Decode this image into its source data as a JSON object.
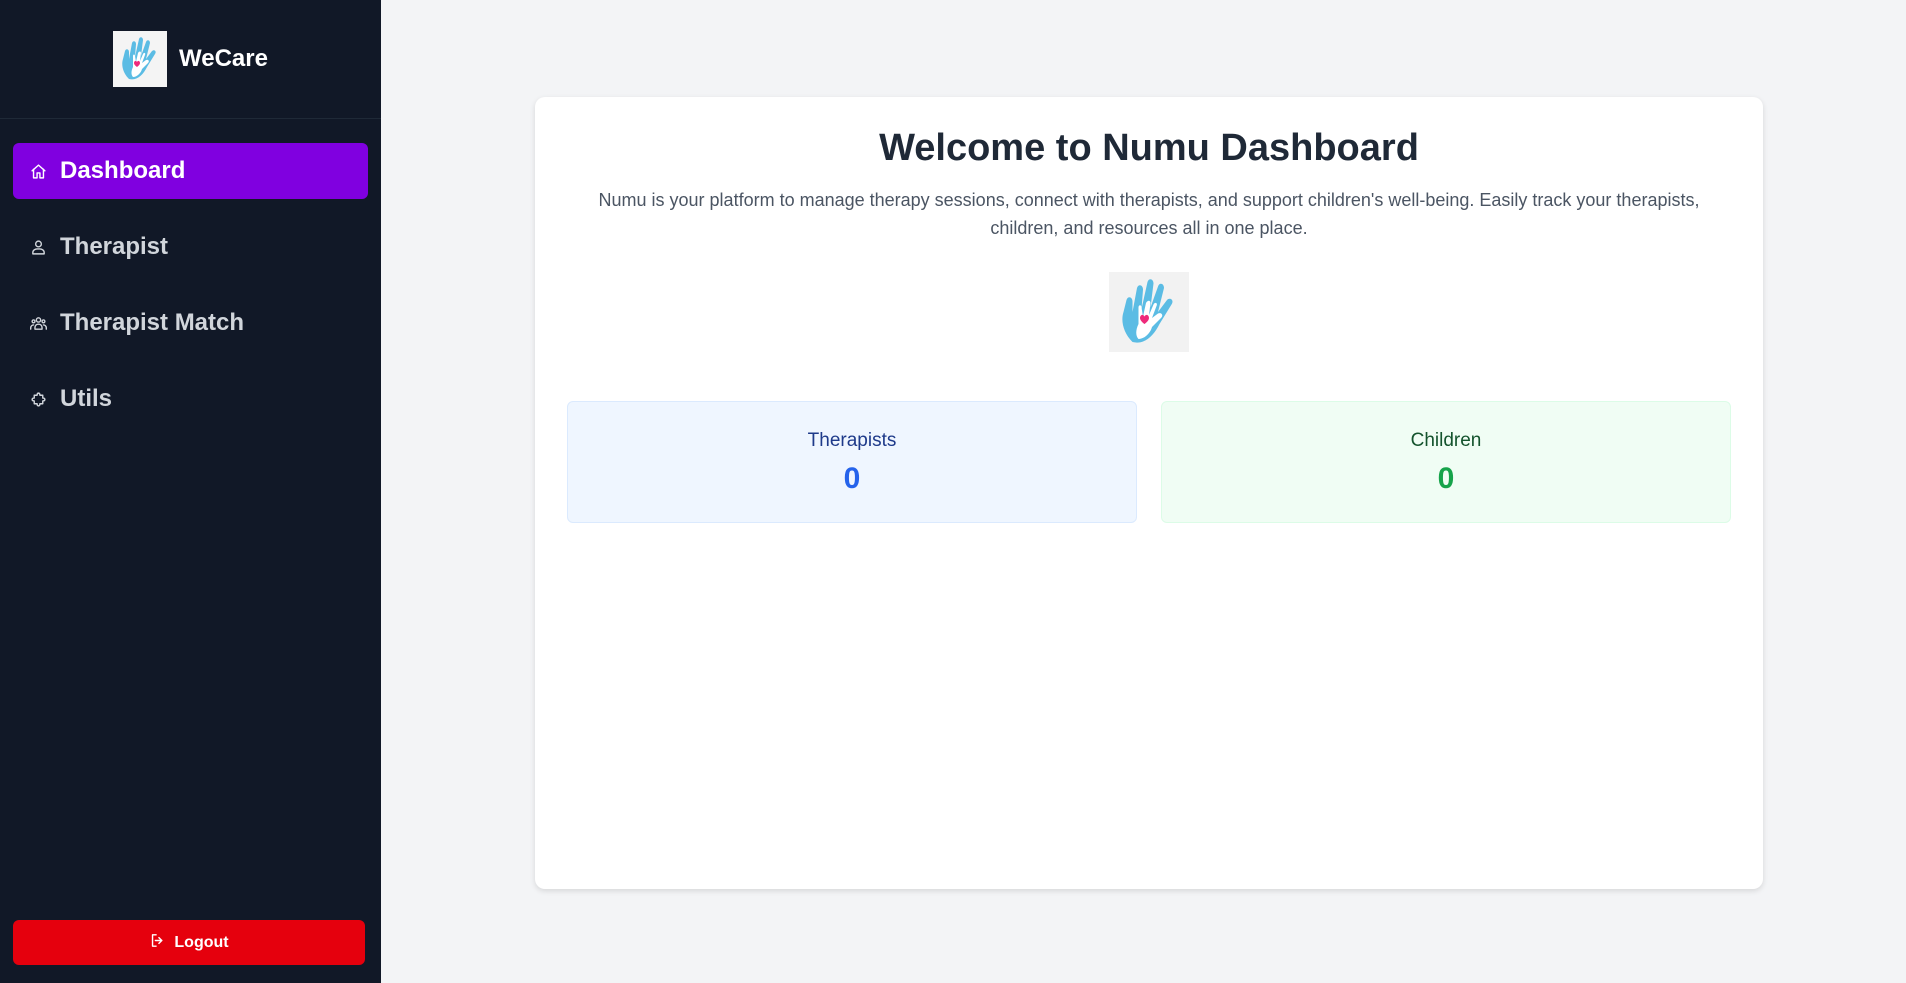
{
  "brand": {
    "name": "WeCare",
    "logo_icon": "helping-hand-heart-icon"
  },
  "nav": {
    "items": [
      {
        "label": "Dashboard",
        "icon": "home-icon",
        "active": true
      },
      {
        "label": "Therapist",
        "icon": "users-icon",
        "active": false
      },
      {
        "label": "Therapist Match",
        "icon": "user-group-icon",
        "active": false
      },
      {
        "label": "Utils",
        "icon": "puzzle-icon",
        "active": false
      }
    ]
  },
  "logout": {
    "label": "Logout",
    "icon": "logout-icon"
  },
  "main": {
    "title": "Welcome to Numu Dashboard",
    "description": "Numu is your platform to manage therapy sessions, connect with therapists, and support children's well-being. Easily track your therapists, children, and resources all in one place.",
    "logo_icon": "helping-hand-heart-icon",
    "stats": [
      {
        "label": "Therapists",
        "value": "0"
      },
      {
        "label": "Children",
        "value": "0"
      }
    ]
  },
  "colors": {
    "sidebar_bg": "#111827",
    "active_nav": "#8000e0",
    "logout_bg": "#e5000d",
    "stat_blue": "#2563eb",
    "stat_green": "#16a34a"
  }
}
